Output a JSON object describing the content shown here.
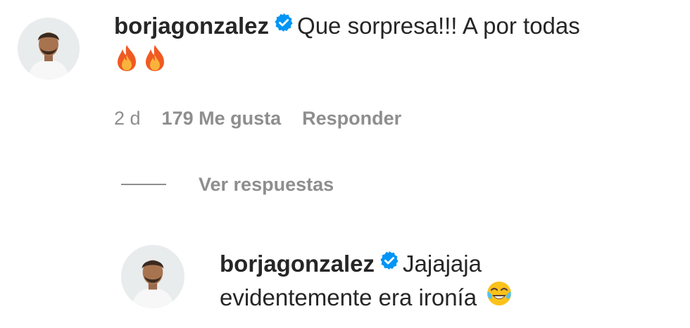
{
  "comment": {
    "username": "borjagonzalez",
    "verified_icon": "verified-badge-icon",
    "text_line1": "Que sorpresa!!! A por todas",
    "emojis": [
      "fire-emoji",
      "fire-emoji"
    ],
    "time": "2 d",
    "likes": "179 Me gusta",
    "reply_label": "Responder"
  },
  "replies": {
    "toggle_label": "Ver respuestas"
  },
  "reply": {
    "username": "borjagonzalez",
    "verified_icon": "verified-badge-icon",
    "text_line1": "Jajajaja",
    "text_line2": "evidentemente era ironía",
    "emoji": "tears-of-joy-emoji"
  },
  "colors": {
    "text": "#262626",
    "secondary": "#8e8e8e",
    "verified": "#0095f6"
  }
}
